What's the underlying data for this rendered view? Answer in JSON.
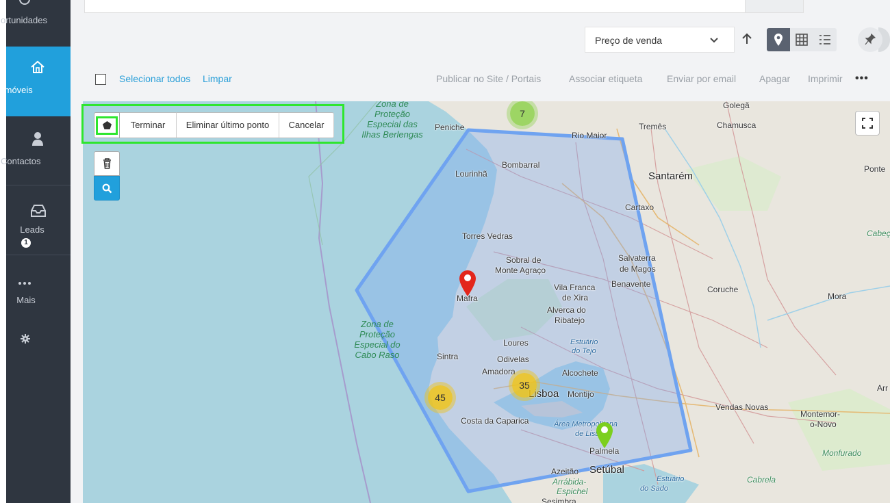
{
  "sidebar": {
    "items": [
      {
        "label": "ortunidades",
        "icon": "target-icon"
      },
      {
        "label": "Imóveis",
        "icon": "home-icon",
        "active": true
      },
      {
        "label": "Contactos",
        "icon": "user-icon"
      },
      {
        "label": "Leads",
        "icon": "inbox-icon",
        "badge": "1"
      },
      {
        "label": "Mais",
        "icon": "dots-icon"
      },
      {
        "label": "",
        "icon": "gear-icon"
      }
    ]
  },
  "toolbar": {
    "sort_label": "Preço de venda",
    "select_all": "Selecionar todos",
    "clear": "Limpar",
    "actions": [
      "Publicar no Site / Portais",
      "Associar etiqueta",
      "Enviar por email",
      "Apagar",
      "Imprimir"
    ],
    "more": "•••"
  },
  "draw": {
    "finish": "Terminar",
    "delete_last": "Eliminar último ponto",
    "cancel": "Cancelar"
  },
  "map": {
    "clusters": [
      {
        "label": "7",
        "color": "#8fd14f"
      },
      {
        "label": "35",
        "color": "#f0c419"
      },
      {
        "label": "45",
        "color": "#f0c419"
      }
    ],
    "markers": [
      {
        "name": "red-map-marker",
        "color": "#e3261b"
      },
      {
        "name": "green-map-marker",
        "color": "#7ccf1e"
      }
    ],
    "places": {
      "golega": "Golegã",
      "chamusca": "Chamusca",
      "peniche": "Peniche",
      "rio_maior": "Rio Maior",
      "tremes": "Tremês",
      "bombarral": "Bombarral",
      "lourinha": "Lourinhã",
      "santarem": "Santarém",
      "ponte": "Ponte",
      "cartaxo": "Cartaxo",
      "cabeca": "Cabeça",
      "torres_vedras": "Torres Vedras",
      "sobral_1": "Sobral de",
      "sobral_2": "Monte Agraço",
      "salvaterra_1": "Salvaterra",
      "salvaterra_2": "de Magos",
      "benavente": "Benavente",
      "mafra": "Mafra",
      "vila_franca_1": "Vila Franca",
      "vila_franca_2": "de Xira",
      "coruche": "Coruche",
      "mora": "Mora",
      "alverca_1": "Alverca do",
      "alverca_2": "Ribatejo",
      "loures": "Loures",
      "sintra": "Sintra",
      "odivelas": "Odivelas",
      "amadora": "Amadora",
      "lisboa": "Lisboa",
      "alcochete": "Alcochete",
      "montijo": "Montijo",
      "arr": "Arr",
      "vendas_novas": "Vendas Novas",
      "montemor_1": "Montemor-",
      "montemor_2": "o-Novo",
      "costa_caparica": "Costa da Caparica",
      "area_metro_1": "Área Metropolitana",
      "area_metro_2": "de Lisboa",
      "palmela": "Palmela",
      "monfurado": "Monfurado",
      "setubal": "Setúbal",
      "azeitao": "Azeitão",
      "arrabida": "Arrábida-",
      "espichel": "Espichel",
      "estuario_sado_1": "Estuário",
      "estuario_sado_2": "do Sado",
      "cabrela": "Cabrela",
      "sesimbra": "Sesimbra",
      "estuario_tejo_1": "Estuário",
      "estuario_tejo_2": "do Tejo",
      "zona_top": "Zona de Proteção Especial das Ilhas Berlengas",
      "zona_bottom": "Zona de Proteção Especial do Cabo Raso"
    }
  }
}
